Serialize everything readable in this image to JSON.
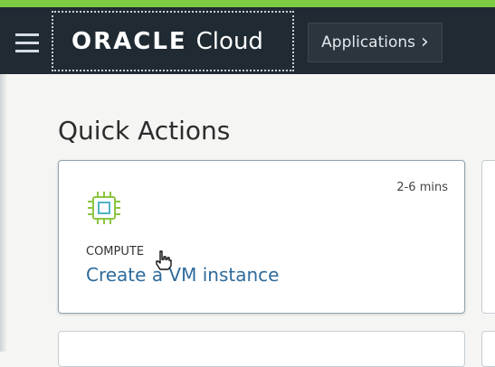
{
  "header": {
    "brand_name": "ORACLE",
    "brand_product": "Cloud",
    "applications_label": "Applications",
    "menu_icon": "hamburger-menu-icon",
    "chevron_icon": "chevron-right-icon"
  },
  "colors": {
    "topbar": "#1f2a32",
    "accent": "#7dcd44",
    "link": "#2e6b9c",
    "chip": "#8cc63f"
  },
  "main": {
    "section_title": "Quick Actions",
    "cards": [
      {
        "time": "2-6 mins",
        "category": "COMPUTE",
        "title": "Create a VM instance",
        "icon": "compute-chip-icon"
      }
    ]
  }
}
